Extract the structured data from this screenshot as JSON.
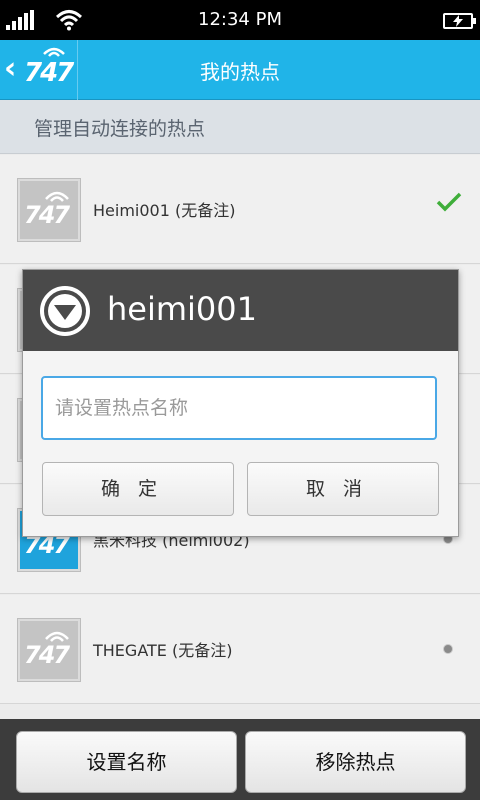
{
  "status_bar": {
    "time": "12:34 PM"
  },
  "title_bar": {
    "back_logo": "747",
    "title": "我的热点"
  },
  "section_header": "管理自动连接的热点",
  "hotspots": [
    {
      "thumb_text": "747",
      "label": "Heimi001 (无备注)",
      "state": "connected"
    },
    {
      "thumb_text": "747",
      "label": "",
      "state": "hidden"
    },
    {
      "thumb_text": "747",
      "label": "",
      "state": "hidden"
    },
    {
      "thumb_text": "747",
      "label": "黑米科技 (heimi002)",
      "state": "saved"
    },
    {
      "thumb_text": "747",
      "label": "THEGATE (无备注)",
      "state": "saved"
    }
  ],
  "dialog": {
    "title": "heimi001",
    "input_value": "",
    "input_placeholder": "请设置热点名称",
    "ok_label": "确定",
    "cancel_label": "取消"
  },
  "bottom_bar": {
    "rename_label": "设置名称",
    "remove_label": "移除热点"
  },
  "colors": {
    "accent": "#20b4e8",
    "check": "#3fae3a",
    "dialog_header": "#4a4a4a"
  }
}
